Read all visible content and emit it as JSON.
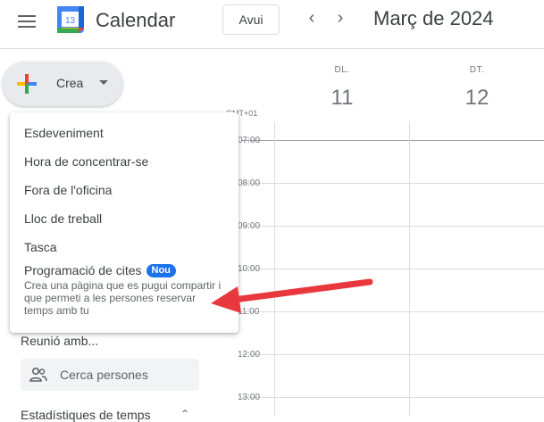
{
  "header": {
    "app_title": "Calendar",
    "logo_text": "13",
    "today_label": "Avui",
    "month_title": "Març de 2024"
  },
  "create": {
    "label": "Crea"
  },
  "week": {
    "days": [
      {
        "dow": "DL.",
        "num": "11"
      },
      {
        "dow": "DT.",
        "num": "12"
      }
    ],
    "timezone": "GMT+01",
    "hours": [
      "07:00",
      "08:00",
      "09:00",
      "10:00",
      "11:00",
      "12:00",
      "13:00"
    ]
  },
  "menu": {
    "items": [
      "Esdeveniment",
      "Hora de concentrar-se",
      "Fora de l'oficina",
      "Lloc de treball",
      "Tasca"
    ],
    "appointment": {
      "label": "Programació de cites",
      "badge": "Nou",
      "description": "Crea una pàgina que es pugui compartir i que permeti a les persones reservar temps amb tu"
    }
  },
  "sidebar": {
    "meet_title": "Reunió amb...",
    "search_people": "Cerca persones",
    "bottom_text": "Estadístiques de temps"
  },
  "colors": {
    "arrow": "#e8383d",
    "badge": "#1a73e8",
    "create_bg": "#e8eaed"
  }
}
